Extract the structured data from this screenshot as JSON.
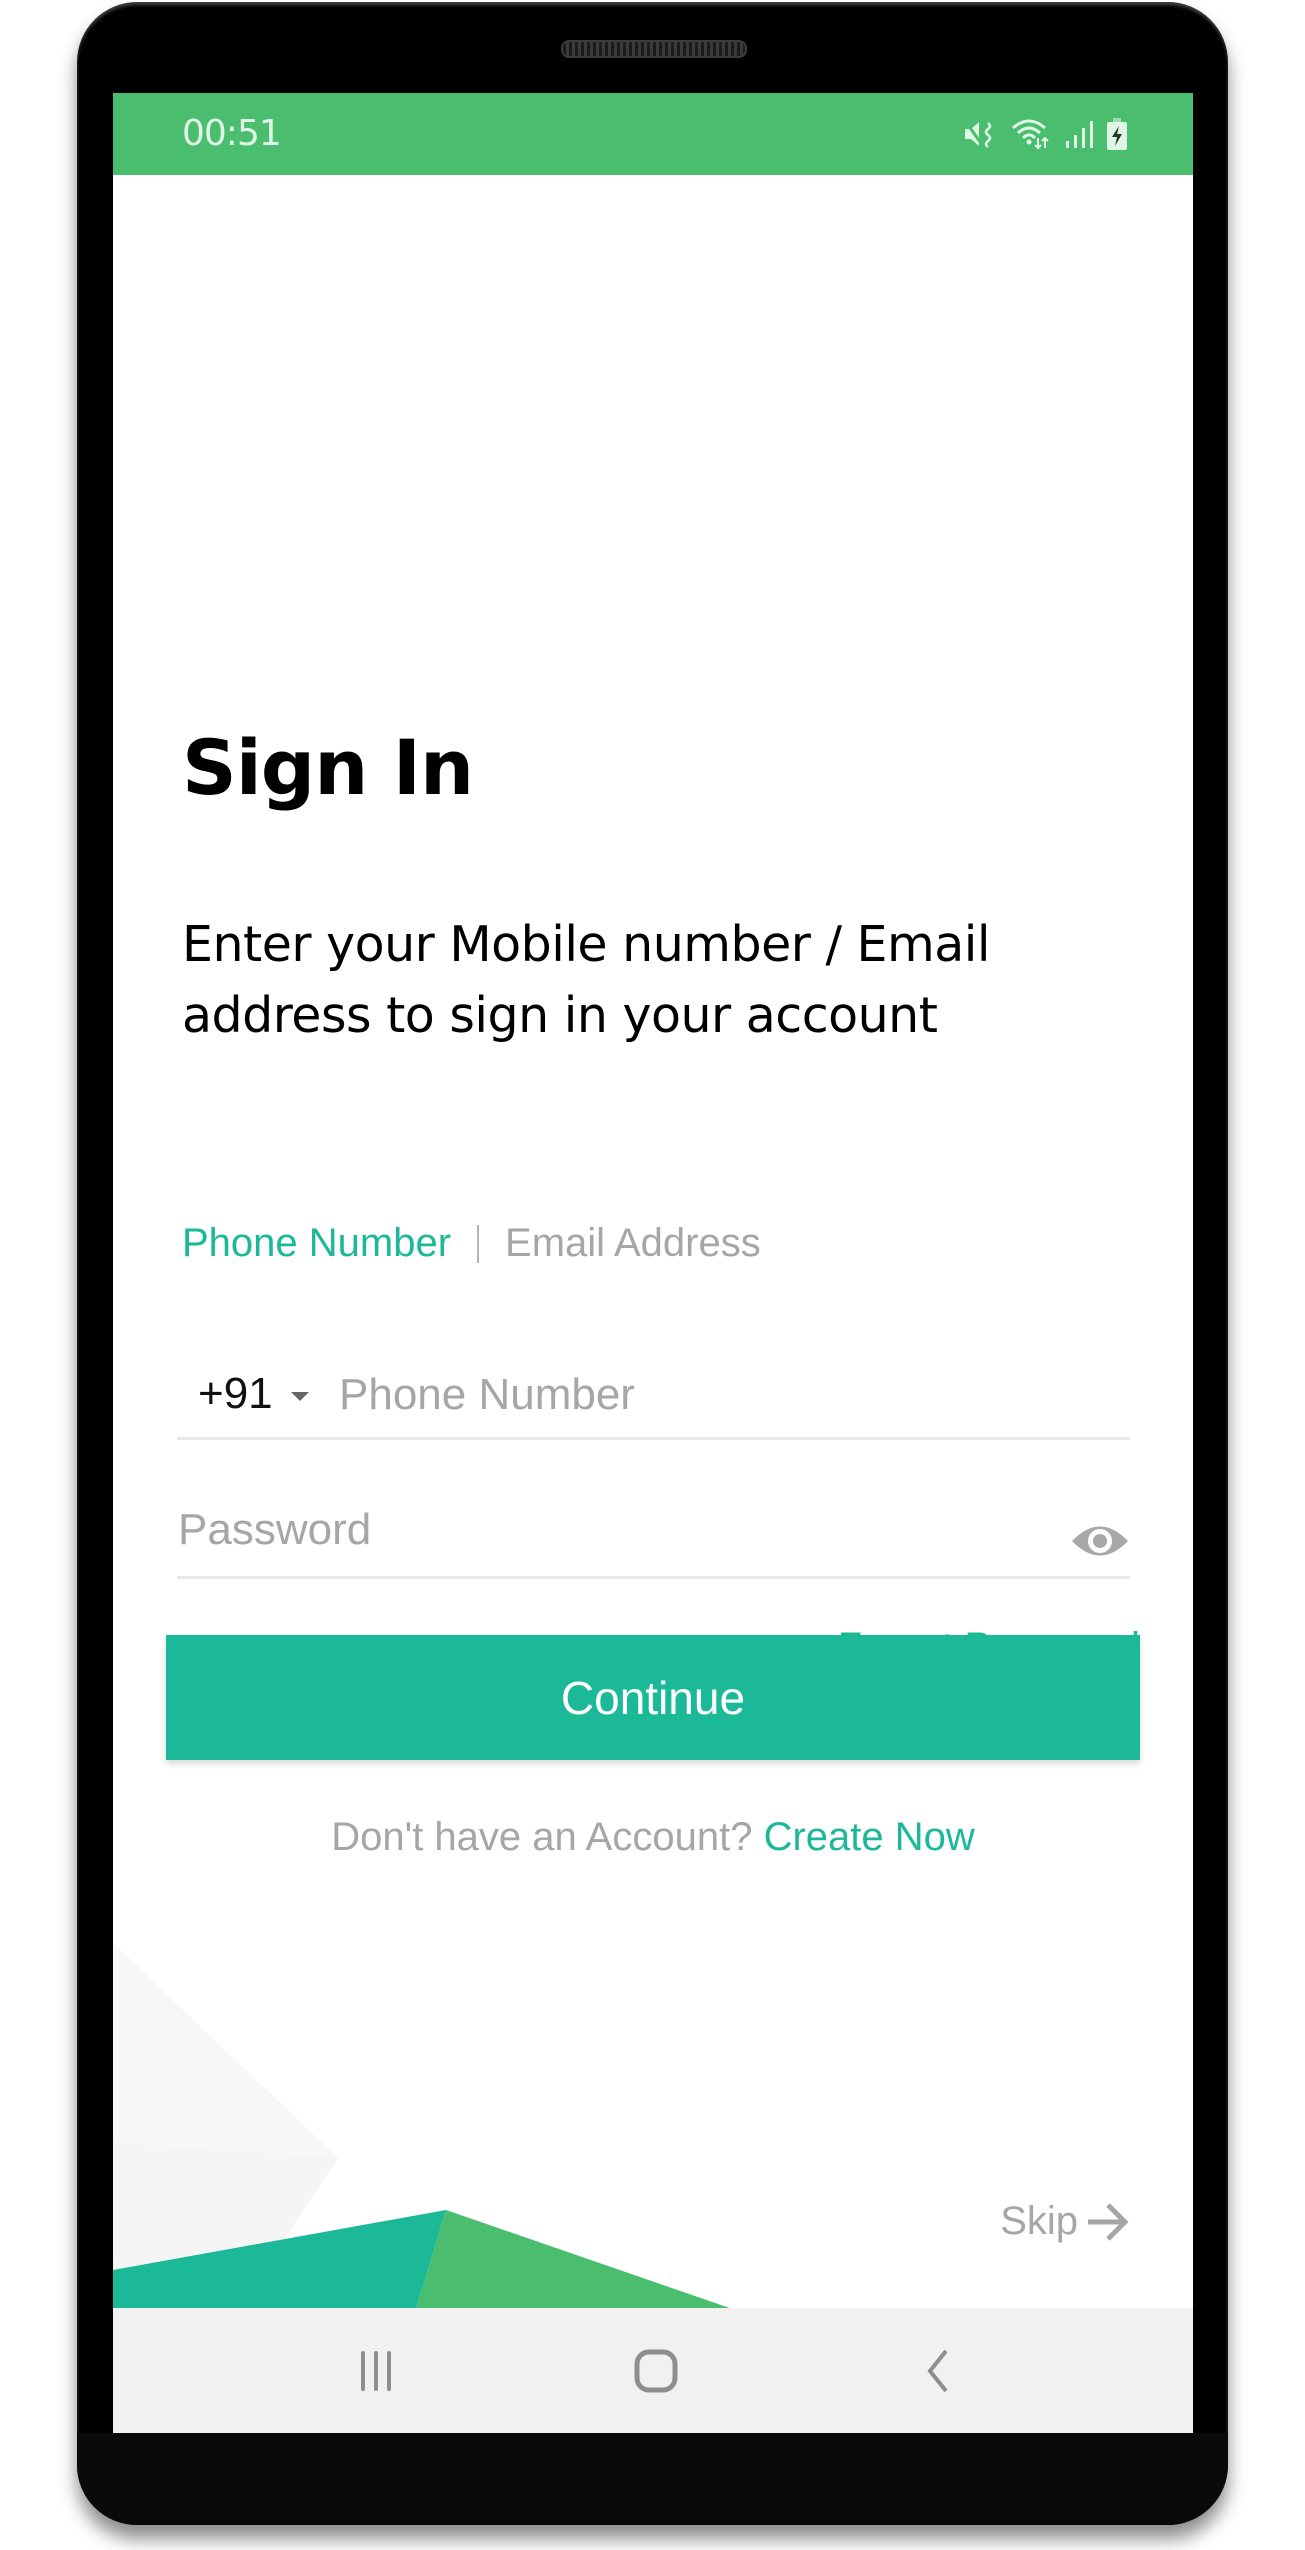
{
  "status_bar": {
    "time": "00:51",
    "icons": [
      "mute-vibrate-icon",
      "wifi-data-icon",
      "signal-icon",
      "battery-charging-icon"
    ]
  },
  "colors": {
    "status_bar": "#4bbd6e",
    "accent_teal": "#1cb998",
    "accent_green": "#4bbd6e",
    "muted_text": "#a6a6a6",
    "nav_bar": "#f1f1f1"
  },
  "signin": {
    "title": "Sign In",
    "subtitle": "Enter your Mobile number / Email address to sign in your account",
    "mode_tabs": [
      {
        "label": "Phone Number",
        "active": true
      },
      {
        "label": "Email Address",
        "active": false
      }
    ],
    "country_code": "+91",
    "phone_field": {
      "value": "",
      "placeholder": "Phone Number"
    },
    "password_field": {
      "value": "",
      "placeholder": "Password"
    },
    "forgot_password": "Forgot Password",
    "continue_label": "Continue",
    "signup_prompt": "Don't have an Account?",
    "signup_link": "Create Now",
    "skip_label": "Skip"
  },
  "nav_bar": {
    "buttons": [
      "recents",
      "home",
      "back"
    ]
  }
}
